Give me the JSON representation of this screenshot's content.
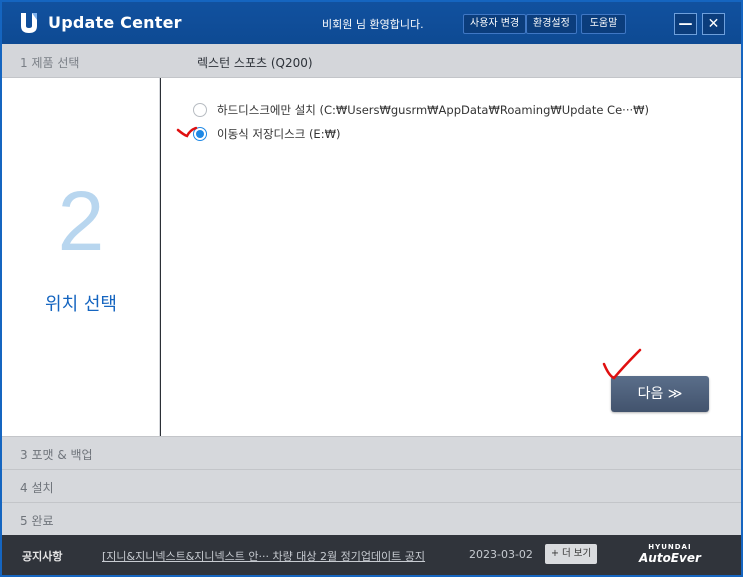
{
  "app": {
    "title": "Update Center",
    "welcome": "비회원 님 환영합니다.",
    "buttons": {
      "change_user": "사용자 변경",
      "settings": "환경설정",
      "help": "도움말"
    },
    "window": {
      "minimize": "—",
      "close": "✕"
    }
  },
  "step1": {
    "label": "1  제품 선택",
    "value": "렉스턴 스포츠 (Q200)"
  },
  "step2": {
    "number": "2",
    "name": "위치 선택"
  },
  "options": [
    {
      "label": "하드디스크에만 설치 (C:₩Users₩gusrm₩AppData₩Roaming₩Update  Ce···₩)",
      "checked": false
    },
    {
      "label": "이동식 저장디스크 (E:₩)",
      "checked": true
    }
  ],
  "next_button": "다음  ≫",
  "steps": {
    "step3": "3  포맷 & 백업",
    "step4": "4  설치",
    "step5": "5  완료"
  },
  "notice": {
    "label": "공지사항",
    "text": "[지니&지니넥스트&지니넥스트  안··· 차량 대상 2월 정기업데이트 공지",
    "date": "2023-03-02",
    "more": "+ 더 보기"
  },
  "brand": {
    "top": "HYUNDAI",
    "bottom": "AutoEver"
  },
  "colors": {
    "titlebar": "#11519f",
    "accent": "#1565c0",
    "step_number": "#b8d6ef",
    "next_button": "#4f6080",
    "annotation": "#e01010"
  }
}
